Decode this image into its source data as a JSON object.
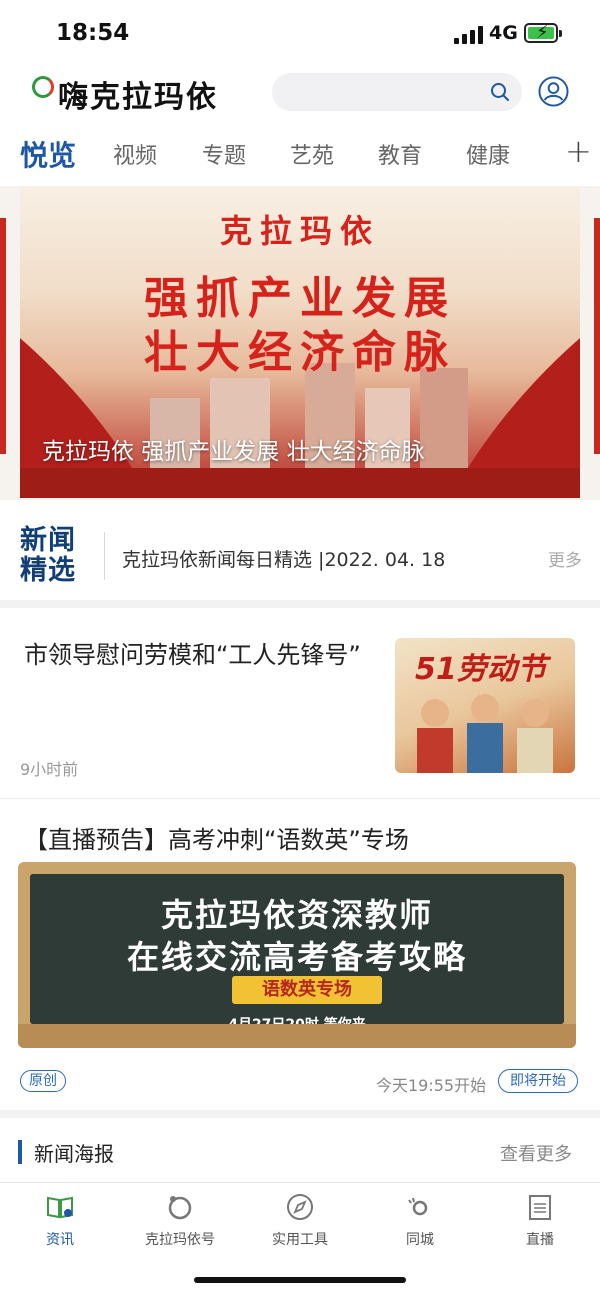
{
  "status": {
    "time": "18:54",
    "network": "4G"
  },
  "header": {
    "app_name": "嗨克拉玛依",
    "search_placeholder": ""
  },
  "tabs": [
    "悦览",
    "视频",
    "专题",
    "艺苑",
    "教育",
    "健康"
  ],
  "banner": {
    "line1": "克拉玛依",
    "line2": "强抓产业发展",
    "line3": "壮大经济命脉",
    "caption": "克拉玛依  强抓产业发展  壮大经济命脉"
  },
  "news_select": {
    "badge_line1": "新闻",
    "badge_line2": "精选",
    "headline": "克拉玛依新闻每日精选  |2022. 04. 18",
    "more": "更多"
  },
  "article1": {
    "title": "市领导慰问劳模和“工人先锋号”",
    "time": "9小时前",
    "thumb_text": "51劳动节"
  },
  "article2": {
    "title": "【直播预告】高考冲刺“语数英”专场",
    "board_line1": "克拉玛依资深教师",
    "board_line2": "在线交流高考备考攻略",
    "board_ribbon": "语数英专场",
    "board_line3": "4月27日20时 等你来",
    "tag": "原创",
    "start_time": "今天19:55开始",
    "live_button": "即将开始"
  },
  "posters": {
    "title": "新闻海报",
    "more": "查看更多"
  },
  "bottom_nav": [
    "资讯",
    "克拉玛依号",
    "实用工具",
    "同城",
    "直播"
  ],
  "colors": {
    "accent": "#1d57a6",
    "banner_red": "#d5231c",
    "battery": "#3cc24a"
  }
}
